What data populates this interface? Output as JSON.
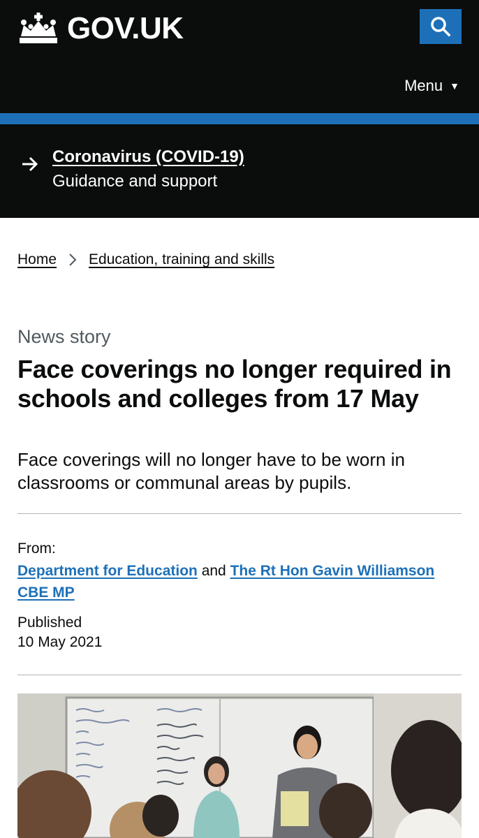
{
  "header": {
    "logo_text": "GOV.UK",
    "menu_label": "Menu",
    "menu_caret": "▼",
    "colors": {
      "background": "#0b0c0c",
      "accent": "#1d70b8"
    }
  },
  "covid_banner": {
    "title": "Coronavirus (COVID-19)",
    "subtitle": "Guidance and support"
  },
  "breadcrumbs": [
    {
      "label": "Home"
    },
    {
      "label": "Education, training and skills"
    }
  ],
  "article": {
    "doc_type": "News story",
    "title": "Face coverings no longer required in schools and colleges from 17 May",
    "lede": "Face coverings will no longer have to be worn in classrooms or communal areas by pupils."
  },
  "metadata": {
    "from_label": "From:",
    "organisations": [
      "Department for Education",
      "The Rt Hon Gavin Williamson CBE MP"
    ],
    "joiner": "and",
    "published_label": "Published",
    "published_date": "10 May 2021"
  },
  "icons": {
    "search": "search-icon",
    "arrow": "arrow-right-icon",
    "breadcrumb_separator": "chevron-right-icon",
    "crown": "crown-logo-icon"
  }
}
